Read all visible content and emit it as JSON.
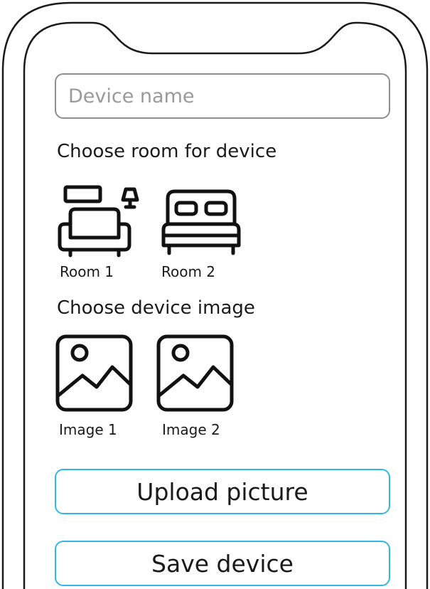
{
  "form": {
    "device_name_placeholder": "Device name",
    "device_name_value": ""
  },
  "rooms": {
    "heading": "Choose room for device",
    "items": [
      {
        "label": "Room 1",
        "icon": "living-room-icon"
      },
      {
        "label": "Room 2",
        "icon": "bed-icon"
      }
    ]
  },
  "images": {
    "heading": "Choose device image",
    "items": [
      {
        "label": "Image 1",
        "icon": "image-icon"
      },
      {
        "label": "Image 2",
        "icon": "image-icon"
      }
    ]
  },
  "actions": {
    "upload_label": "Upload picture",
    "save_label": "Save device"
  },
  "colors": {
    "button_border": "#2fb8e6",
    "input_border": "#8e8e8e",
    "icon_stroke": "#111111"
  }
}
